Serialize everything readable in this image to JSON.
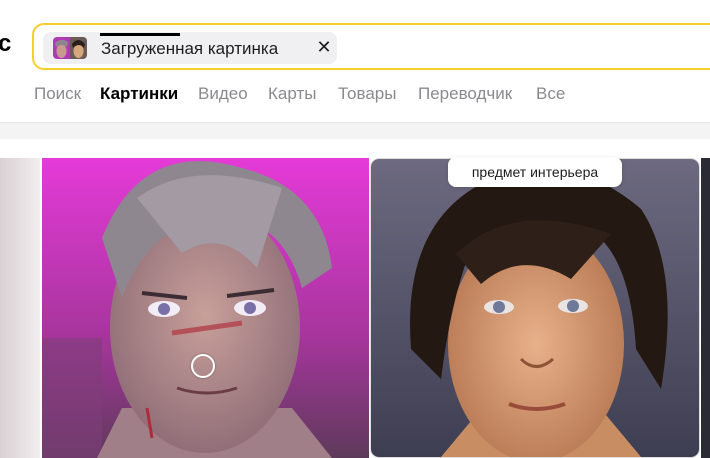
{
  "header": {
    "logo_fragment": "с"
  },
  "search": {
    "chip_label": "Загруженная картинка",
    "chip_close_glyph": "✕"
  },
  "tabs": [
    {
      "label": "Поиск",
      "active": false
    },
    {
      "label": "Картинки",
      "active": true
    },
    {
      "label": "Видео",
      "active": false
    },
    {
      "label": "Карты",
      "active": false
    },
    {
      "label": "Товары",
      "active": false
    },
    {
      "label": "Переводчик",
      "active": false
    },
    {
      "label": "Все",
      "active": false
    }
  ],
  "results": {
    "tooltip": "предмет интерьера"
  },
  "colors": {
    "accent_yellow": "#f7cf2a",
    "active_tab": "#000000",
    "inactive_tab": "#8a8a8e"
  }
}
